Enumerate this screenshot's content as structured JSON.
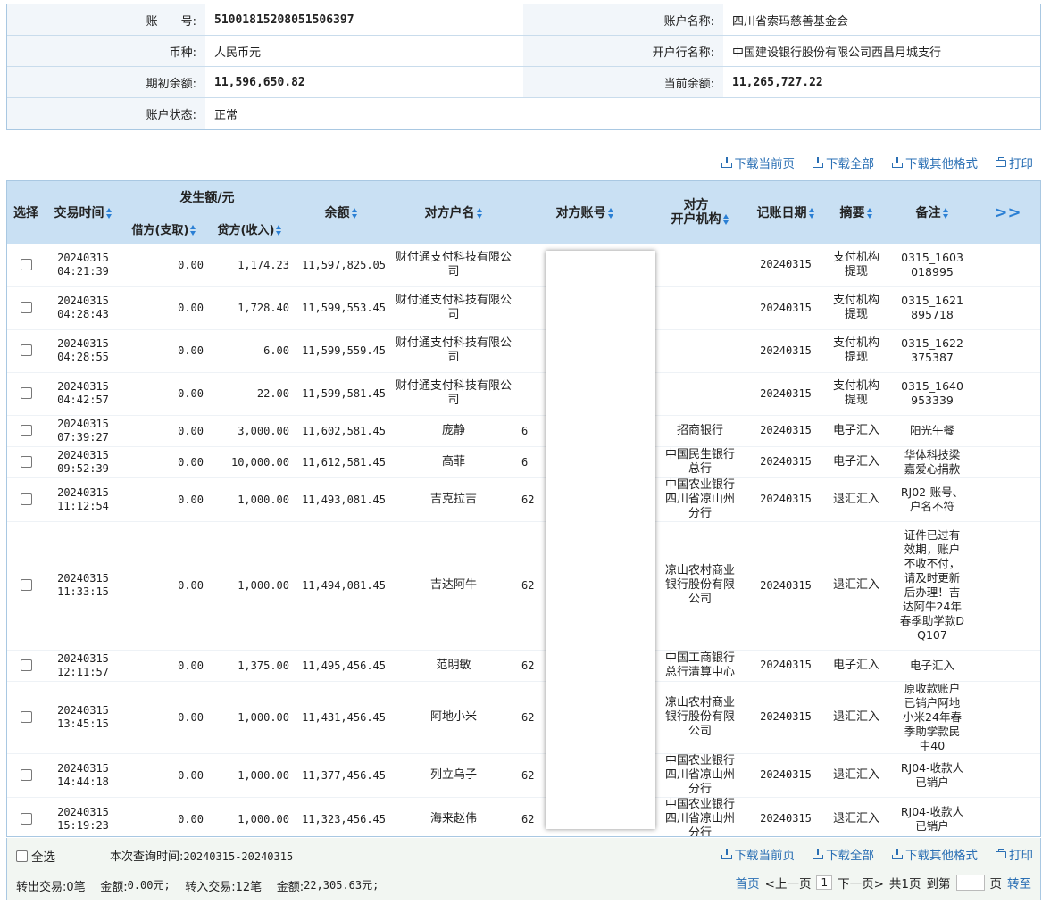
{
  "account": {
    "acct_no_label": "账　　号:",
    "acct_no": "51001815208051506397",
    "acct_name_label": "账户名称:",
    "acct_name": "四川省索玛慈善基金会",
    "currency_label": "币种:",
    "currency": "人民币元",
    "bank_label": "开户行名称:",
    "bank": "中国建设银行股份有限公司西昌月城支行",
    "opening_label": "期初余额:",
    "opening": "11,596,650.82",
    "current_label": "当前余额:",
    "current": "11,265,727.22",
    "status_label": "账户状态:",
    "status": "正常"
  },
  "toolbar": {
    "download_page": "下载当前页",
    "download_all": "下载全部",
    "download_other": "下载其他格式",
    "print": "打印"
  },
  "headers": {
    "select": "选择",
    "time": "交易时间",
    "amount_group": "发生额/元",
    "debit": "借方(支取)",
    "credit": "贷方(收入)",
    "balance": "余额",
    "cp_name": "对方户名",
    "cp_account": "对方账号",
    "cp_bank": "对方\n开户机构",
    "book_date": "记账日期",
    "summary": "摘要",
    "remark": "备注",
    "expand": ">>"
  },
  "rows": [
    {
      "date": "20240315",
      "time": "04:21:39",
      "debit": "0.00",
      "credit": "1,174.23",
      "balance": "11,597,825.05",
      "name": "财付通支付科技有限公司",
      "acct": "",
      "bank": "",
      "book": "20240315",
      "summary": "支付机构提现",
      "remark": "0315_1603018995"
    },
    {
      "date": "20240315",
      "time": "04:28:43",
      "debit": "0.00",
      "credit": "1,728.40",
      "balance": "11,599,553.45",
      "name": "财付通支付科技有限公司",
      "acct": "",
      "bank": "",
      "book": "20240315",
      "summary": "支付机构提现",
      "remark": "0315_1621895718"
    },
    {
      "date": "20240315",
      "time": "04:28:55",
      "debit": "0.00",
      "credit": "6.00",
      "balance": "11,599,559.45",
      "name": "财付通支付科技有限公司",
      "acct": "",
      "bank": "",
      "book": "20240315",
      "summary": "支付机构提现",
      "remark": "0315_1622375387"
    },
    {
      "date": "20240315",
      "time": "04:42:57",
      "debit": "0.00",
      "credit": "22.00",
      "balance": "11,599,581.45",
      "name": "财付通支付科技有限公司",
      "acct": "",
      "bank": "",
      "book": "20240315",
      "summary": "支付机构提现",
      "remark": "0315_1640953339"
    },
    {
      "date": "20240315",
      "time": "07:39:27",
      "debit": "0.00",
      "credit": "3,000.00",
      "balance": "11,602,581.45",
      "name": "庞静",
      "acct": "6",
      "bank": "招商银行",
      "book": "20240315",
      "summary": "电子汇入",
      "remark": "阳光午餐"
    },
    {
      "date": "20240315",
      "time": "09:52:39",
      "debit": "0.00",
      "credit": "10,000.00",
      "balance": "11,612,581.45",
      "name": "高菲",
      "acct": "6",
      "bank": "中国民生银行总行",
      "book": "20240315",
      "summary": "电子汇入",
      "remark": "华体科技梁嘉爱心捐款"
    },
    {
      "date": "20240315",
      "time": "11:12:54",
      "debit": "0.00",
      "credit": "1,000.00",
      "balance": "11,493,081.45",
      "name": "吉克拉吉",
      "acct": "62",
      "bank": "中国农业银行四川省凉山州分行",
      "book": "20240315",
      "summary": "退汇汇入",
      "remark": "RJ02-账号、户名不符"
    },
    {
      "date": "20240315",
      "time": "11:33:15",
      "debit": "0.00",
      "credit": "1,000.00",
      "balance": "11,494,081.45",
      "name": "吉达阿牛",
      "acct": "62",
      "bank": "凉山农村商业银行股份有限公司",
      "book": "20240315",
      "summary": "退汇汇入",
      "remark": "证件已过有效期，账户不收不付，请及时更新后办理！吉达阿牛24年春季助学款DQ107"
    },
    {
      "date": "20240315",
      "time": "12:11:57",
      "debit": "0.00",
      "credit": "1,375.00",
      "balance": "11,495,456.45",
      "name": "范明敏",
      "acct": "62",
      "bank": "中国工商银行总行清算中心",
      "book": "20240315",
      "summary": "电子汇入",
      "remark": "电子汇入"
    },
    {
      "date": "20240315",
      "time": "13:45:15",
      "debit": "0.00",
      "credit": "1,000.00",
      "balance": "11,431,456.45",
      "name": "阿地小米",
      "acct": "62",
      "bank": "凉山农村商业银行股份有限公司",
      "book": "20240315",
      "summary": "退汇汇入",
      "remark": "原收款账户已销户阿地小米24年春季助学款民中40"
    },
    {
      "date": "20240315",
      "time": "14:44:18",
      "debit": "0.00",
      "credit": "1,000.00",
      "balance": "11,377,456.45",
      "name": "列立乌子",
      "acct": "62",
      "bank": "中国农业银行四川省凉山州分行",
      "book": "20240315",
      "summary": "退汇汇入",
      "remark": "RJ04-收款人已销户"
    },
    {
      "date": "20240315",
      "time": "15:19:23",
      "debit": "0.00",
      "credit": "1,000.00",
      "balance": "11,323,456.45",
      "name": "海来赵伟",
      "acct": "62",
      "bank": "中国农业银行四川省凉山州分行",
      "book": "20240315",
      "summary": "退汇汇入",
      "remark": "RJ04-收款人已销户"
    }
  ],
  "footer": {
    "select_all": "全选",
    "query_label": "本次查询时间:",
    "query_range": "20240315-20240315",
    "out_label": "转出交易:",
    "out_count": "0笔",
    "out_amt_label": "金额:",
    "out_amt": "0.00元;",
    "in_label": "转入交易:",
    "in_count": "12笔",
    "in_amt_label": "金额:",
    "in_amt": "22,305.63元;",
    "first": "首页",
    "prev": "<上一页",
    "page": "1",
    "next": "下一页>",
    "total": "共1页",
    "goto": "到第",
    "page_unit": "页",
    "go": "转至"
  }
}
